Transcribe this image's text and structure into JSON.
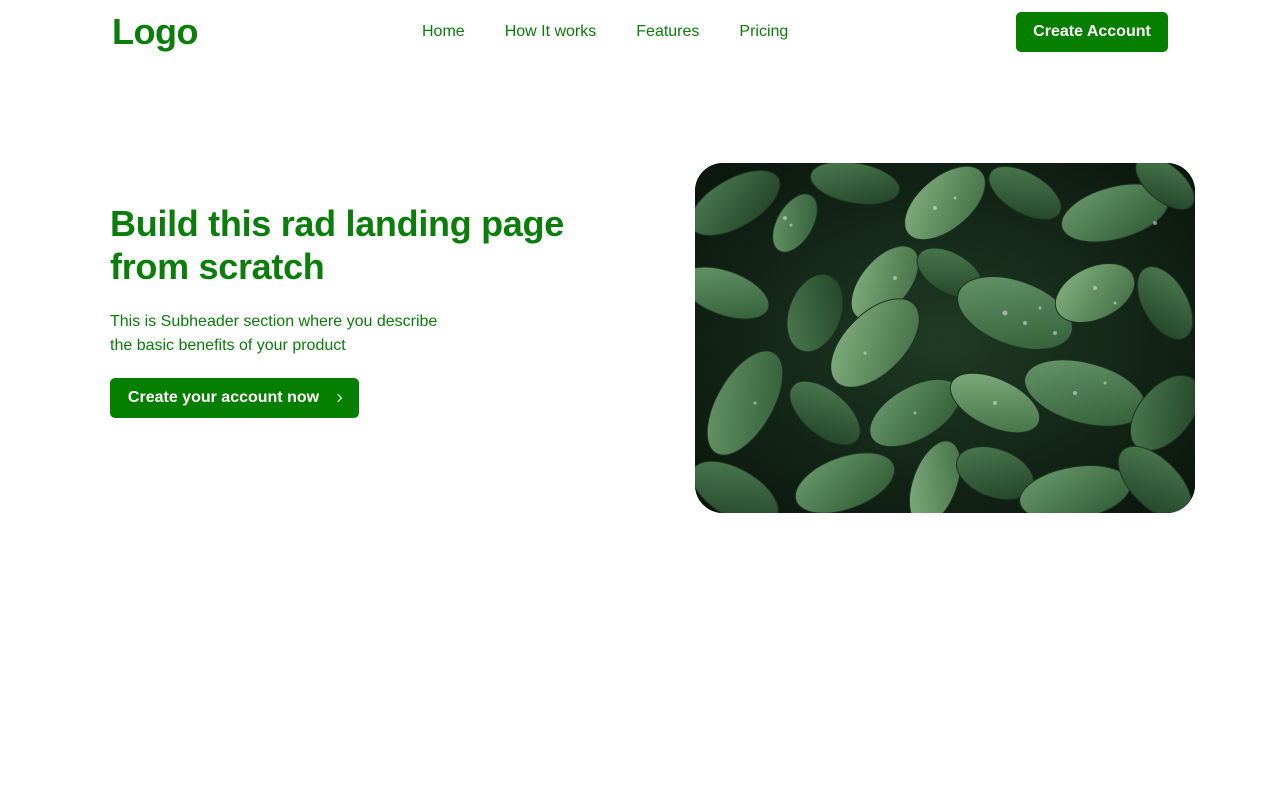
{
  "header": {
    "logo": "Logo",
    "nav": [
      "Home",
      "How It works",
      "Features",
      "Pricing"
    ],
    "cta_label": "Create Account"
  },
  "hero": {
    "title": "Build this rad landing page from scratch",
    "subtitle_line1": "This is Subheader section where you describe",
    "subtitle_line2": "the basic benefits of your product",
    "cta_label": "Create your account now",
    "image_icon": "leaves-photo"
  },
  "colors": {
    "brand_green": "#0a7d0a",
    "button_green": "#067f00",
    "background": "#ffffff"
  }
}
